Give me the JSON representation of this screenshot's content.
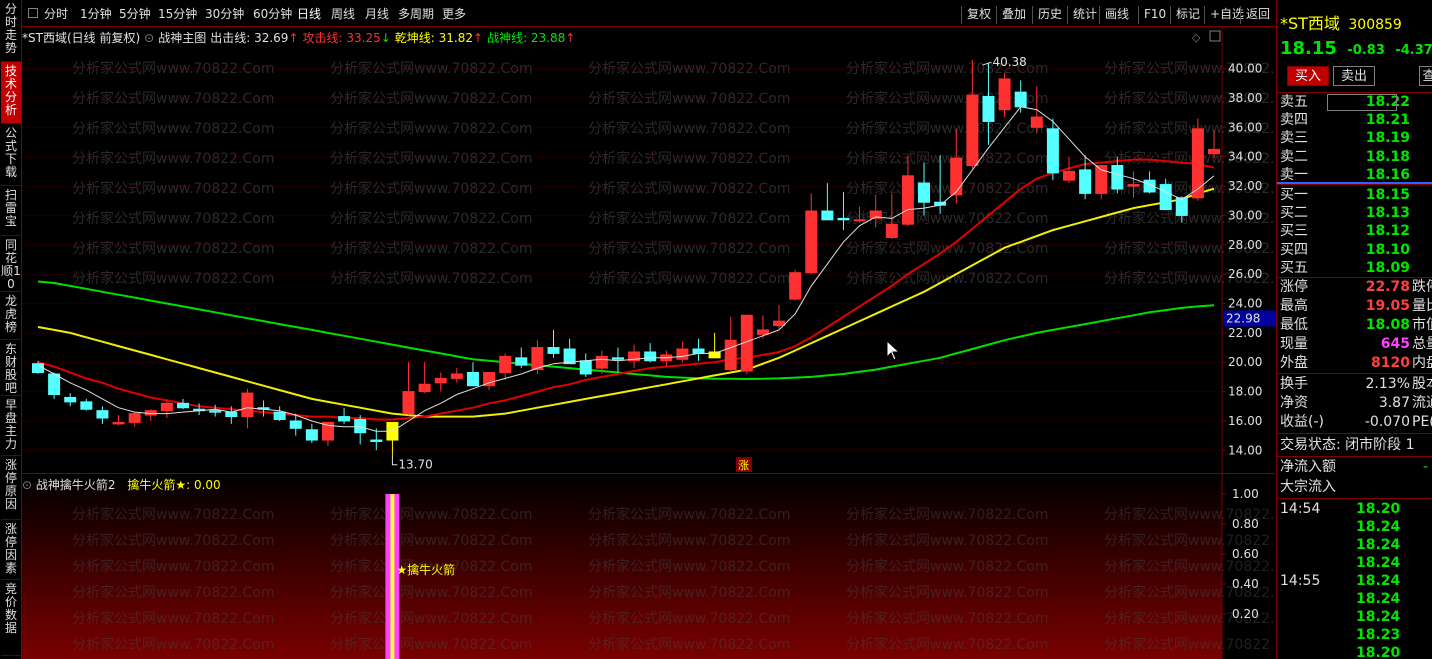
{
  "sidebar": {
    "tabs": [
      {
        "label": "分时走势",
        "active": false
      },
      {
        "label": "技术分析",
        "active": true
      },
      {
        "label": "公式下载",
        "active": false
      },
      {
        "label": "扫雷宝",
        "active": false
      },
      {
        "label": "同花顺10",
        "active": false
      },
      {
        "label": "龙虎榜",
        "active": false
      },
      {
        "label": "东财股吧",
        "active": false
      },
      {
        "label": "早盘主力",
        "active": false
      },
      {
        "label": "涨停原因",
        "active": false
      },
      {
        "label": "涨停因素",
        "active": false
      },
      {
        "label": "竞价数据",
        "active": false
      }
    ]
  },
  "toolbar": {
    "periods": [
      "分时",
      "1分钟",
      "5分钟",
      "15分钟",
      "30分钟",
      "60分钟",
      "日线",
      "周线",
      "月线",
      "多周期",
      "更多"
    ],
    "active_period": "日线",
    "right_buttons": [
      "复权",
      "叠加",
      "历史",
      "统计",
      "画线",
      "F10",
      "标记",
      "+自选",
      "返回"
    ]
  },
  "legend": {
    "title": "*ST西域(日线 前复权)",
    "indicator": "战神主图",
    "items": [
      {
        "label": "出击线: 32.69",
        "arrow": "↑",
        "color": "#e0e0e0",
        "arrow_color": "#ff3030"
      },
      {
        "label": "攻击线: 33.25",
        "arrow": "↓",
        "color": "#ff3030",
        "arrow_color": "#00e600"
      },
      {
        "label": "乾坤线: 31.82",
        "arrow": "↑",
        "color": "#ffff00",
        "arrow_color": "#ff3030"
      },
      {
        "label": "战神线: 23.88",
        "arrow": "↑",
        "color": "#00e600",
        "arrow_color": "#ff3030"
      }
    ]
  },
  "indicator_panel": {
    "name": "战神擒牛火箭2",
    "line_label": "擒牛火箭★: 0.00",
    "signal_label": "★擒牛火箭",
    "y_ticks": [
      "1.00",
      "0.80",
      "0.60",
      "0.40",
      "0.20"
    ]
  },
  "watermark": "分析家公式网www.70822.Com",
  "chart_data": {
    "type": "candlestick",
    "y_ticks": [
      "40.00",
      "38.00",
      "36.00",
      "34.00",
      "32.00",
      "30.00",
      "28.00",
      "26.00",
      "24.00",
      "22.00",
      "20.00",
      "18.00",
      "16.00",
      "14.00"
    ],
    "ylim": [
      13.0,
      41.2
    ],
    "current_price_label": "22.98",
    "high_label": "40.38",
    "low_label": "13.70",
    "rise_marker": "涨",
    "candles": [
      [
        19.9,
        20.1,
        19.2,
        19.3
      ],
      [
        19.2,
        19.3,
        17.5,
        17.8
      ],
      [
        17.6,
        17.9,
        17.0,
        17.3
      ],
      [
        17.3,
        17.5,
        16.7,
        16.8
      ],
      [
        16.7,
        17.0,
        15.8,
        16.2
      ],
      [
        15.8,
        16.4,
        15.7,
        15.9
      ],
      [
        15.9,
        16.6,
        15.6,
        16.5
      ],
      [
        16.4,
        16.8,
        16.0,
        16.7
      ],
      [
        16.7,
        17.4,
        16.2,
        17.2
      ],
      [
        17.2,
        17.5,
        16.8,
        16.9
      ],
      [
        16.8,
        17.2,
        16.4,
        16.7
      ],
      [
        16.7,
        17.1,
        16.3,
        16.6
      ],
      [
        16.6,
        17.0,
        15.8,
        16.3
      ],
      [
        16.3,
        18.2,
        15.5,
        17.9
      ],
      [
        16.9,
        17.4,
        16.3,
        16.8
      ],
      [
        16.6,
        17.0,
        16.0,
        16.1
      ],
      [
        16.0,
        16.5,
        15.0,
        15.5
      ],
      [
        15.4,
        15.8,
        14.5,
        14.7
      ],
      [
        14.7,
        15.9,
        14.3,
        15.9
      ],
      [
        16.3,
        16.9,
        15.8,
        16.0
      ],
      [
        16.1,
        16.4,
        14.4,
        15.2
      ],
      [
        14.7,
        15.5,
        14.0,
        14.6
      ],
      [
        14.7,
        15.8,
        13.7,
        15.9
      ],
      [
        16.5,
        20.0,
        16.4,
        18.0
      ],
      [
        18.0,
        20.0,
        17.9,
        18.5
      ],
      [
        18.6,
        19.3,
        18.0,
        18.9
      ],
      [
        18.9,
        19.6,
        18.6,
        19.2
      ],
      [
        19.3,
        20.0,
        18.8,
        18.4
      ],
      [
        18.4,
        19.2,
        18.1,
        19.3
      ],
      [
        19.3,
        20.6,
        18.8,
        20.4
      ],
      [
        20.3,
        21.0,
        19.6,
        19.8
      ],
      [
        19.5,
        21.5,
        19.2,
        21.0
      ],
      [
        21.0,
        22.2,
        20.3,
        20.6
      ],
      [
        20.9,
        21.6,
        20.1,
        19.9
      ],
      [
        20.1,
        20.6,
        19.0,
        19.2
      ],
      [
        19.6,
        20.8,
        19.2,
        20.4
      ],
      [
        20.3,
        21.0,
        19.3,
        20.2
      ],
      [
        20.1,
        21.2,
        19.6,
        20.7
      ],
      [
        20.7,
        21.3,
        20.0,
        20.1
      ],
      [
        20.1,
        20.8,
        19.7,
        20.5
      ],
      [
        20.2,
        21.4,
        20.0,
        20.9
      ],
      [
        20.9,
        21.6,
        20.1,
        20.6
      ],
      [
        20.7,
        22.0,
        20.3,
        20.3
      ],
      [
        19.5,
        23.1,
        19.4,
        21.5
      ],
      [
        19.4,
        23.2,
        19.2,
        23.2
      ],
      [
        21.9,
        23.2,
        21.6,
        22.2
      ],
      [
        22.5,
        23.9,
        22.3,
        22.8
      ],
      [
        24.3,
        26.3,
        24.2,
        26.1
      ],
      [
        26.1,
        31.5,
        26.0,
        30.3
      ],
      [
        30.3,
        32.2,
        29.7,
        29.7
      ],
      [
        29.8,
        31.6,
        29.0,
        29.7
      ],
      [
        29.7,
        30.6,
        29.5,
        29.7
      ],
      [
        29.8,
        31.4,
        29.2,
        30.3
      ],
      [
        28.5,
        31.5,
        28.4,
        29.4
      ],
      [
        29.4,
        34.1,
        29.3,
        32.7
      ],
      [
        32.2,
        33.6,
        30.0,
        30.9
      ],
      [
        30.9,
        34.1,
        30.1,
        30.7
      ],
      [
        31.4,
        35.9,
        30.8,
        33.9
      ],
      [
        33.4,
        40.6,
        33.2,
        38.2
      ],
      [
        38.1,
        40.4,
        34.8,
        36.4
      ],
      [
        37.2,
        39.7,
        36.7,
        39.3
      ],
      [
        38.4,
        39.2,
        37.0,
        37.4
      ],
      [
        36.0,
        38.8,
        35.6,
        36.7
      ],
      [
        35.9,
        36.6,
        32.4,
        32.9
      ],
      [
        32.4,
        34.0,
        32.2,
        33.0
      ],
      [
        33.1,
        34.1,
        31.1,
        31.5
      ],
      [
        31.5,
        32.6,
        31.1,
        33.4
      ],
      [
        33.4,
        34.0,
        31.5,
        31.8
      ],
      [
        32.0,
        33.0,
        31.2,
        32.1
      ],
      [
        32.4,
        33.0,
        31.5,
        31.6
      ],
      [
        32.1,
        32.5,
        30.4,
        30.4
      ],
      [
        31.2,
        31.3,
        29.5,
        30.0
      ],
      [
        31.2,
        36.6,
        31.0,
        35.9
      ],
      [
        34.2,
        35.8,
        33.9,
        34.5
      ]
    ],
    "ma_white": [
      19.8,
      19.2,
      18.6,
      18.1,
      17.5,
      16.9,
      16.6,
      16.5,
      16.5,
      16.6,
      16.7,
      16.8,
      16.6,
      16.9,
      16.8,
      16.7,
      16.4,
      16.0,
      15.7,
      15.6,
      15.6,
      15.3,
      15.3,
      16.0,
      16.7,
      17.2,
      17.8,
      18.2,
      18.6,
      18.9,
      19.2,
      19.6,
      19.9,
      20.0,
      20.1,
      20.2,
      20.1,
      20.2,
      20.3,
      20.3,
      20.4,
      20.6,
      20.6,
      21.0,
      21.4,
      21.8,
      22.2,
      23.3,
      25.2,
      26.7,
      28.2,
      29.3,
      29.9,
      29.8,
      30.4,
      30.5,
      30.7,
      31.6,
      33.1,
      34.6,
      36.0,
      37.4,
      37.2,
      36.4,
      35.2,
      34.0,
      33.1,
      32.8,
      32.5,
      32.1,
      31.6,
      31.1,
      31.8,
      32.7
    ],
    "ma_red": [
      20.0,
      19.7,
      19.3,
      18.9,
      18.6,
      18.2,
      17.9,
      17.6,
      17.4,
      17.2,
      17.0,
      16.9,
      16.8,
      16.7,
      16.6,
      16.5,
      16.4,
      16.3,
      16.3,
      16.2,
      16.2,
      16.1,
      16.1,
      16.2,
      16.3,
      16.5,
      16.7,
      16.9,
      17.2,
      17.4,
      17.7,
      18.0,
      18.3,
      18.5,
      18.8,
      19.0,
      19.2,
      19.4,
      19.6,
      19.7,
      19.8,
      19.9,
      20.0,
      20.2,
      20.3,
      20.5,
      20.7,
      21.1,
      21.7,
      22.4,
      23.1,
      23.8,
      24.5,
      25.2,
      26.0,
      26.7,
      27.4,
      28.2,
      29.1,
      30.0,
      30.9,
      31.8,
      32.5,
      32.9,
      33.2,
      33.5,
      33.6,
      33.7,
      33.8,
      33.8,
      33.7,
      33.6,
      33.5,
      33.25
    ],
    "ma_yellow": [
      22.4,
      22.2,
      22.0,
      21.7,
      21.4,
      21.1,
      20.8,
      20.5,
      20.2,
      19.9,
      19.6,
      19.3,
      19.0,
      18.7,
      18.4,
      18.1,
      17.8,
      17.5,
      17.3,
      17.1,
      16.9,
      16.7,
      16.5,
      16.4,
      16.3,
      16.3,
      16.3,
      16.3,
      16.4,
      16.5,
      16.7,
      16.9,
      17.1,
      17.3,
      17.5,
      17.7,
      17.9,
      18.1,
      18.3,
      18.5,
      18.7,
      18.9,
      19.1,
      19.3,
      19.5,
      19.9,
      20.3,
      20.8,
      21.3,
      21.8,
      22.3,
      22.8,
      23.3,
      23.8,
      24.3,
      24.8,
      25.4,
      26.0,
      26.6,
      27.2,
      27.8,
      28.2,
      28.6,
      29.0,
      29.3,
      29.6,
      29.9,
      30.2,
      30.5,
      30.7,
      30.9,
      31.1,
      31.5,
      31.82
    ],
    "ma_green": [
      25.5,
      25.4,
      25.2,
      25.0,
      24.8,
      24.6,
      24.4,
      24.2,
      24.0,
      23.8,
      23.6,
      23.4,
      23.2,
      23.0,
      22.8,
      22.6,
      22.4,
      22.2,
      22.0,
      21.8,
      21.6,
      21.4,
      21.2,
      21.0,
      20.8,
      20.6,
      20.4,
      20.2,
      20.1,
      20.0,
      19.9,
      19.8,
      19.7,
      19.6,
      19.5,
      19.4,
      19.3,
      19.2,
      19.1,
      19.0,
      18.95,
      18.9,
      18.88,
      18.87,
      18.86,
      18.87,
      18.9,
      18.95,
      19.0,
      19.1,
      19.2,
      19.35,
      19.5,
      19.7,
      19.9,
      20.1,
      20.3,
      20.6,
      20.9,
      21.2,
      21.5,
      21.75,
      22.0,
      22.2,
      22.4,
      22.6,
      22.8,
      23.0,
      23.2,
      23.4,
      23.55,
      23.7,
      23.8,
      23.88
    ],
    "signal_index": 22
  },
  "quote": {
    "name": "*ST西域",
    "code": "300859",
    "price": "18.15",
    "change": "-0.83",
    "change_pct": "-4.37%",
    "buy_btn": "买入",
    "sell_btn": "卖出",
    "query_btn": "查",
    "asks": [
      {
        "label": "卖五",
        "price": "18.22"
      },
      {
        "label": "卖四",
        "price": "18.21"
      },
      {
        "label": "卖三",
        "price": "18.19"
      },
      {
        "label": "卖二",
        "price": "18.18"
      },
      {
        "label": "卖一",
        "price": "18.16"
      }
    ],
    "bids": [
      {
        "label": "买一",
        "price": "18.15"
      },
      {
        "label": "买二",
        "price": "18.13"
      },
      {
        "label": "买三",
        "price": "18.12"
      },
      {
        "label": "买四",
        "price": "18.10"
      },
      {
        "label": "买五",
        "price": "18.09"
      }
    ],
    "stats": [
      {
        "label": "涨停",
        "value": "22.78",
        "color": "#ff4040",
        "extra": "跌停"
      },
      {
        "label": "最高",
        "value": "19.05",
        "color": "#ff4040",
        "extra": "量比"
      },
      {
        "label": "最低",
        "value": "18.08",
        "color": "#00e600",
        "extra": "市值"
      },
      {
        "label": "现量",
        "value": "645",
        "color": "#ff40ff",
        "extra": "总量"
      },
      {
        "label": "外盘",
        "value": "8120",
        "color": "#ff4040",
        "extra": "内盘"
      }
    ],
    "stats2": [
      {
        "label": "换手",
        "value": "2.13%",
        "extra": "股本"
      },
      {
        "label": "净资",
        "value": "3.87",
        "extra": "流通"
      },
      {
        "label": "收益(-)",
        "value": "-0.070",
        "extra": "PE(动"
      }
    ],
    "trade_status": "交易状态: 闭市阶段 1",
    "net_inflow": "净流入额",
    "net_inflow_value": "-",
    "big_inflow": "大宗流入",
    "ticks": [
      {
        "time": "14:54",
        "price": "18.20"
      },
      {
        "time": "",
        "price": "18.24"
      },
      {
        "time": "",
        "price": "18.24"
      },
      {
        "time": "",
        "price": "18.24"
      },
      {
        "time": "14:55",
        "price": "18.24"
      },
      {
        "time": "",
        "price": "18.24"
      },
      {
        "time": "",
        "price": "18.24"
      },
      {
        "time": "",
        "price": "18.23"
      },
      {
        "time": "",
        "price": "18.20"
      }
    ]
  }
}
